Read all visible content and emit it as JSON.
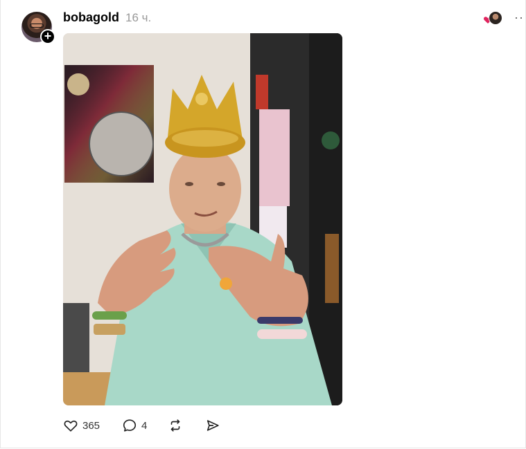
{
  "post": {
    "username": "bobagold",
    "timestamp": "16 ч.",
    "follow_symbol": "+",
    "more_symbol": "··",
    "photo": {
      "icon": "photo-man-in-gold-crown"
    },
    "actions": {
      "likes": "365",
      "replies": "4"
    }
  },
  "colors": {
    "heart": "#e0245e",
    "text_muted": "#999999",
    "crown_gold": "#d4a62a",
    "shirt": "#a8d8c8"
  }
}
